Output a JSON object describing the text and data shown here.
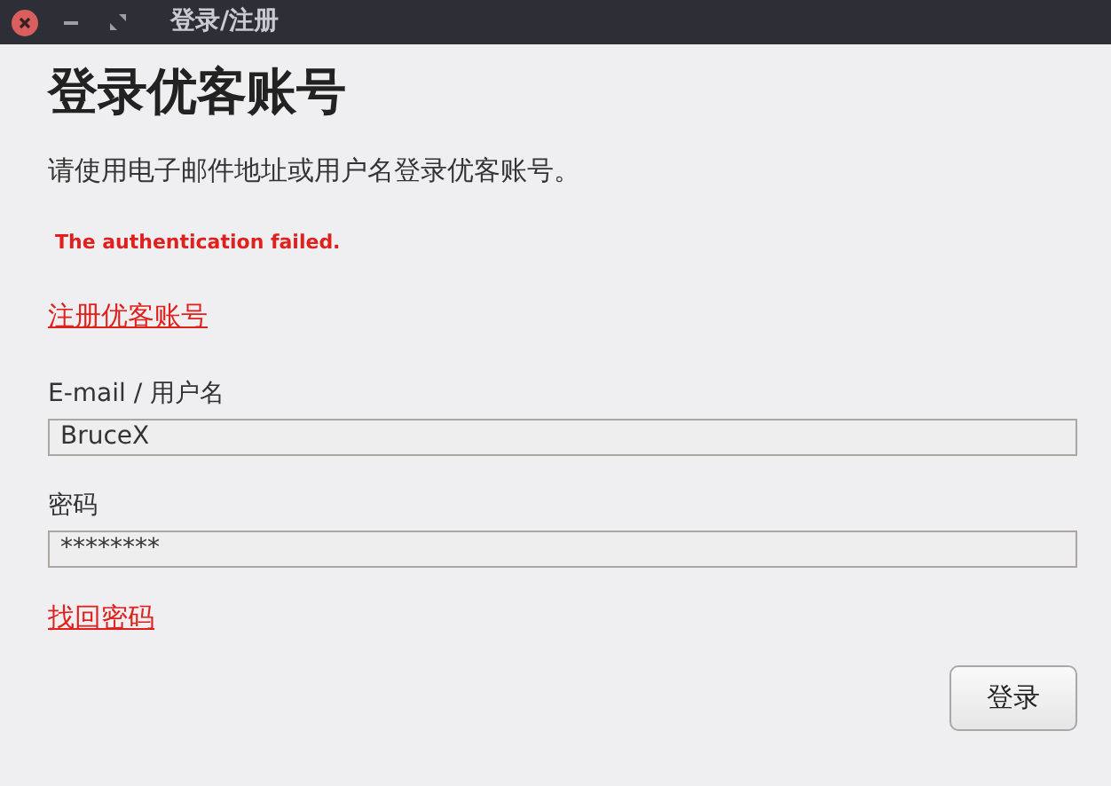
{
  "window": {
    "title": "登录/注册"
  },
  "heading": "登录优客账号",
  "subtitle": "请使用电子邮件地址或用户名登录优客账号。",
  "error": "The authentication failed.",
  "register_link": "注册优客账号",
  "fields": [
    {
      "label": "E-mail / 用户名",
      "value": "BruceX"
    },
    {
      "label": "密码",
      "value": "********"
    }
  ],
  "recover_link": "找回密码",
  "buttons": [
    "登录"
  ]
}
